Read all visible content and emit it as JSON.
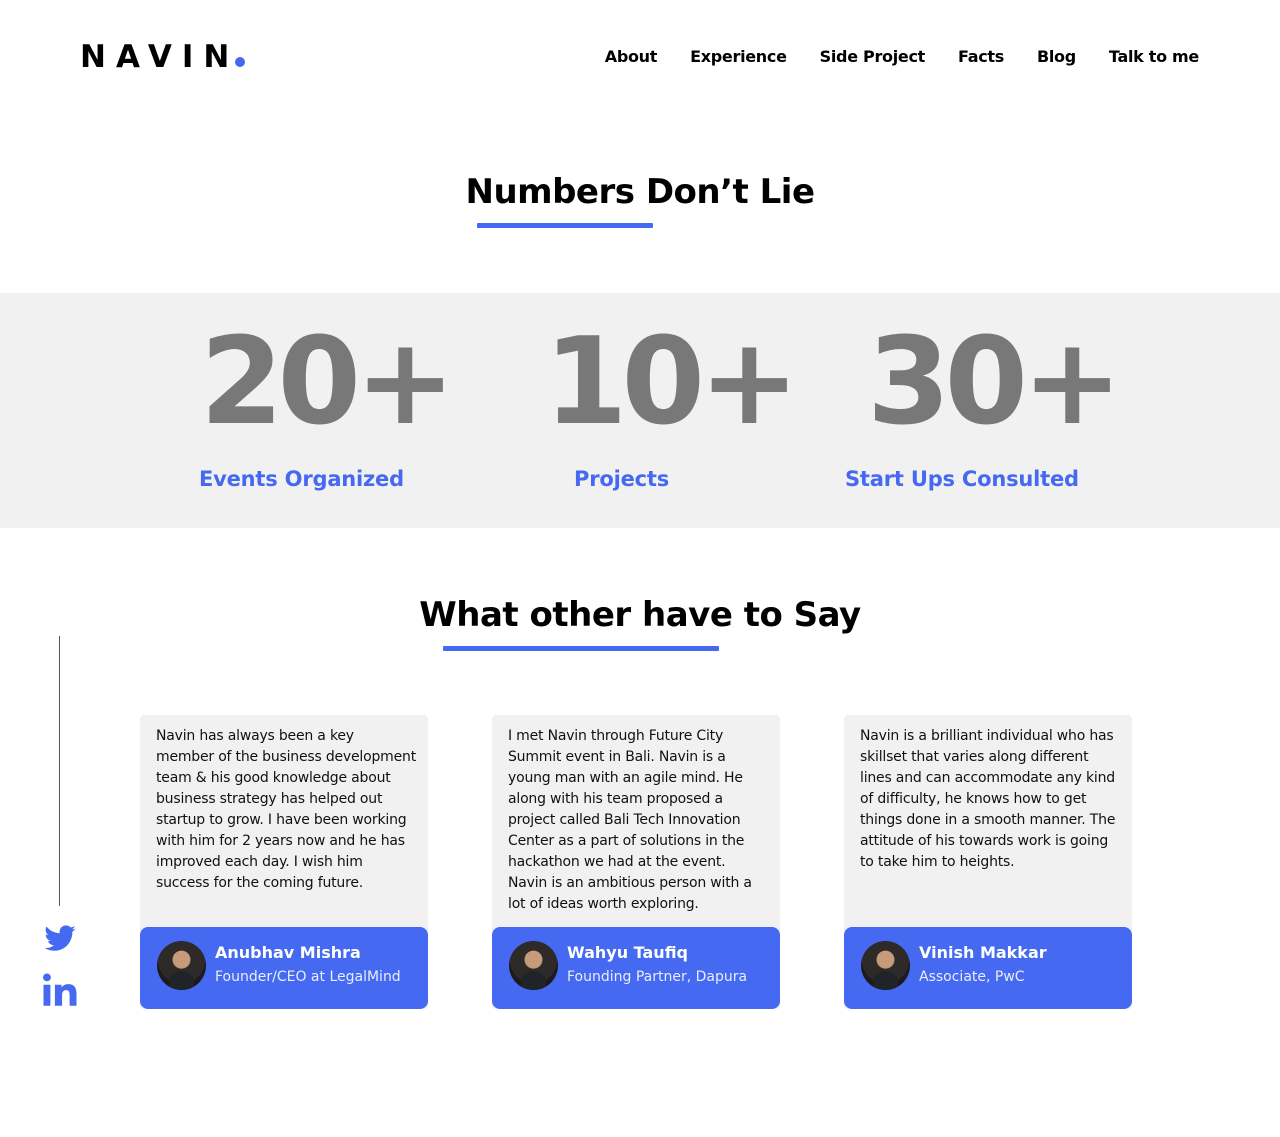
{
  "header": {
    "logo": "NAVIN",
    "nav": [
      "About",
      "Experience",
      "Side Project",
      "Facts",
      "Blog",
      "Talk to me"
    ]
  },
  "facts": {
    "title": "Numbers Don’t Lie",
    "stats": [
      {
        "number": "20+",
        "label": "Events Organized"
      },
      {
        "number": "10+",
        "label": "Projects"
      },
      {
        "number": "30+",
        "label": "Start Ups Consulted"
      }
    ]
  },
  "testimonials": {
    "title": "What other have to Say",
    "items": [
      {
        "quote": "Navin has always been a key member of the business development team & his good knowledge about business strategy has helped out startup to grow. I have been working with him for 2 years now and he has improved each day. I wish him success for the coming future.",
        "name": "Anubhav Mishra",
        "role": "Founder/CEO at LegalMind"
      },
      {
        "quote": "I met Navin through Future City Summit event in Bali. Navin is a young man with an agile mind. He along with his team proposed a project called Bali Tech Innovation Center as a part of solutions in the hackathon we had at the event. Navin is an ambitious person with a lot of ideas worth exploring.",
        "name": "Wahyu Taufiq",
        "role": "Founding Partner, Dapura"
      },
      {
        "quote": "Navin is a brilliant individual who has skillset that varies along different lines and can accommodate any kind of difficulty, he knows how to get things done in a smooth manner. The attitude of his towards work is going to take him to heights.",
        "name": "Vinish Makkar",
        "role": "Associate, PwC"
      }
    ]
  },
  "social": {
    "icons": [
      "twitter-icon",
      "linkedin-icon"
    ]
  },
  "colors": {
    "accent": "#4569f0",
    "stat_number": "#787878",
    "band": "#f1f1f1"
  }
}
